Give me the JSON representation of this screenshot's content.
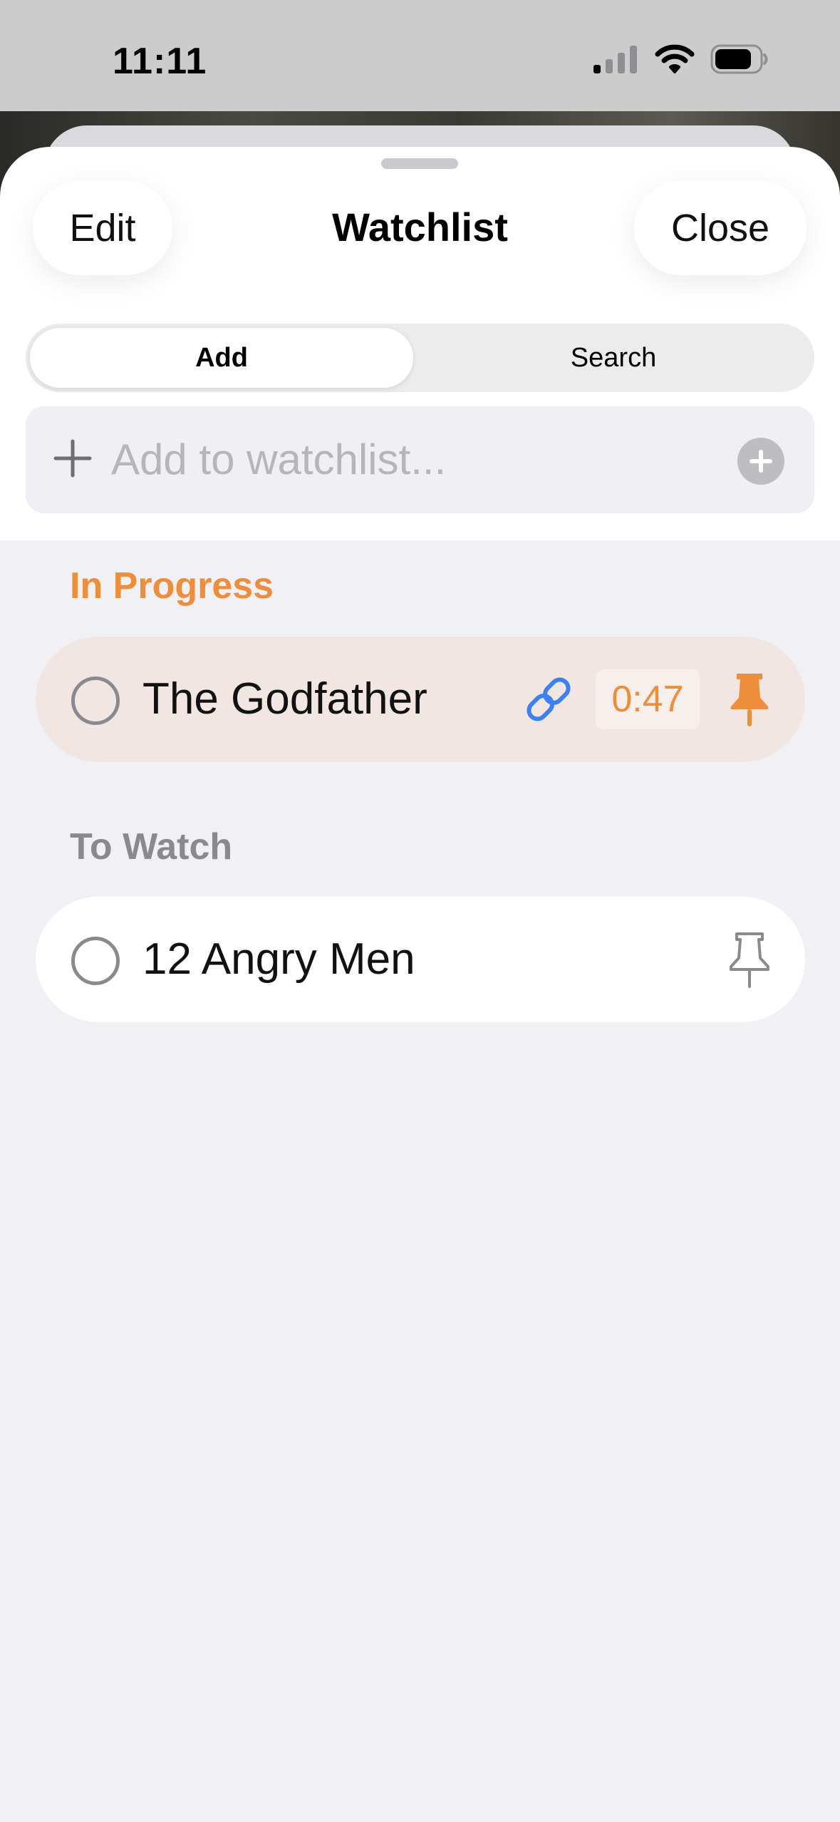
{
  "status_bar": {
    "time": "11:11"
  },
  "header": {
    "edit_label": "Edit",
    "title": "Watchlist",
    "close_label": "Close"
  },
  "segmented_control": {
    "options": [
      "Add",
      "Search"
    ],
    "selected": "Add"
  },
  "add_field": {
    "placeholder": "Add to watchlist..."
  },
  "sections": [
    {
      "title": "In Progress",
      "items": [
        {
          "title": "The Godfather",
          "timer": "0:47",
          "pinned": true,
          "has_link": true
        }
      ]
    },
    {
      "title": "To Watch",
      "items": [
        {
          "title": "12 Angry Men",
          "pinned": false,
          "has_link": false
        }
      ]
    }
  ],
  "colors": {
    "accent": "#ee8d3a",
    "link": "#3b82f0",
    "secondary": "#8a8a8e",
    "in_progress_row": "#f1e6e2",
    "background": "#f1f1f5"
  },
  "icons": {
    "signal": "cellular-signal-icon",
    "wifi": "wifi-icon",
    "battery": "battery-icon",
    "add": "plus-icon",
    "add_circle": "plus-circle-icon",
    "checkbox": "circle-checkbox-icon",
    "link": "link-icon",
    "pin_filled": "pin-filled-icon",
    "pin_outline": "pin-outline-icon"
  }
}
